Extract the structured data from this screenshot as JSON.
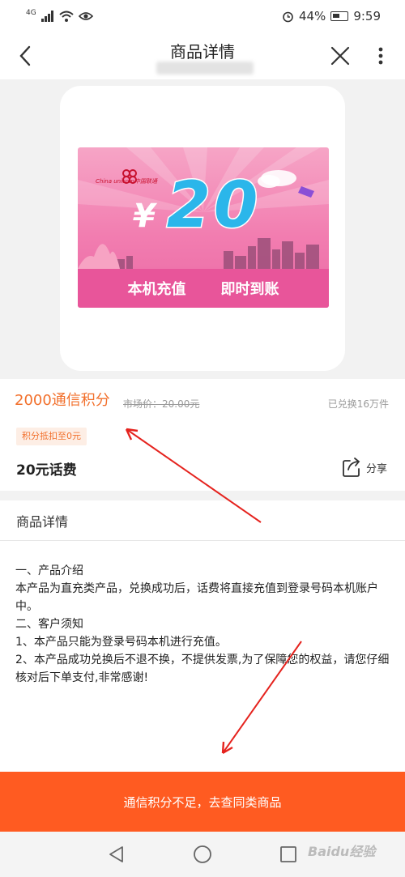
{
  "status_bar": {
    "network": "4G",
    "battery": "44%",
    "time": "9:59"
  },
  "nav": {
    "title": "商品详情"
  },
  "coupon": {
    "brand": "China unicom中国联通",
    "currency": "¥",
    "amount": "20",
    "left_tag": "本机充值",
    "right_tag": "即时到账"
  },
  "product": {
    "points_price": "2000通信积分",
    "market_price": "市场价：20.00元",
    "exchanged": "已兑换16万件",
    "deduct_badge": "积分抵扣至0元",
    "name": "20元话费",
    "share_label": "分享"
  },
  "details": {
    "header": "商品详情",
    "lines": [
      "一、产品介绍",
      "本产品为直充类产品，兑换成功后，话费将直接充值到登录号码本机账户中。",
      "二、客户须知",
      "1、本产品只能为登录号码本机进行充值。",
      "2、本产品成功兑换后不退不换，不提供发票,为了保障您的权益，请您仔细核对后下单支付,非常感谢!"
    ]
  },
  "cta": {
    "label": "通信积分不足，去查同类商品"
  },
  "watermark": "Baidu经验",
  "colors": {
    "accent": "#f2702c",
    "cta": "#ff5b21",
    "annotation": "#e5231e"
  }
}
